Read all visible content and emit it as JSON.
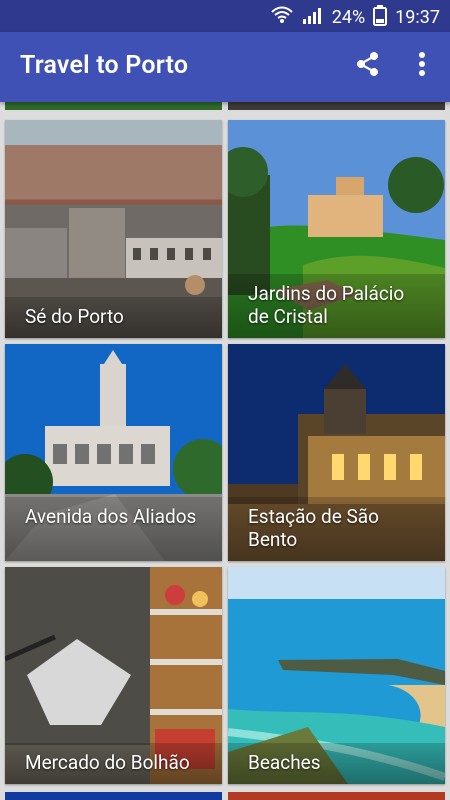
{
  "status": {
    "battery": "24%",
    "time": "19:37"
  },
  "appbar": {
    "title": "Travel to Porto"
  },
  "cards": [
    {
      "label": "Sé do Porto"
    },
    {
      "label": "Jardins do Palácio de Cristal"
    },
    {
      "label": "Avenida dos Aliados"
    },
    {
      "label": "Estação de São Bento"
    },
    {
      "label": "Mercado do Bolhão"
    },
    {
      "label": "Beaches"
    }
  ],
  "icons": {
    "share": "share-icon",
    "more": "more-vert-icon",
    "wifi": "wifi-icon",
    "signal": "signal-icon",
    "battery": "battery-icon"
  },
  "colors": {
    "statusbar": "#2f3a8f",
    "appbar": "#3f51b5"
  }
}
